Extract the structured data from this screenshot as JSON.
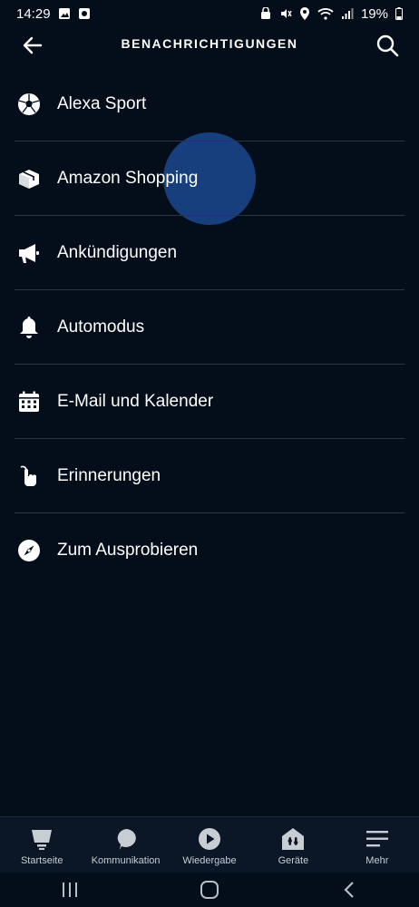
{
  "status_bar": {
    "time": "14:29",
    "battery": "19%"
  },
  "header": {
    "title": "BENACHRICHTIGUNGEN"
  },
  "list": [
    {
      "label": "Alexa Sport",
      "icon": "soccer-ball-icon"
    },
    {
      "label": "Amazon Shopping",
      "icon": "package-icon"
    },
    {
      "label": "Ankündigungen",
      "icon": "megaphone-icon"
    },
    {
      "label": "Automodus",
      "icon": "bell-icon"
    },
    {
      "label": "E-Mail und Kalender",
      "icon": "calendar-icon"
    },
    {
      "label": "Erinnerungen",
      "icon": "tap-hand-icon"
    },
    {
      "label": "Zum Ausprobieren",
      "icon": "compass-icon"
    }
  ],
  "bottom_nav": [
    {
      "label": "Startseite",
      "icon": "home-icon"
    },
    {
      "label": "Kommunikation",
      "icon": "chat-bubble-icon"
    },
    {
      "label": "Wiedergabe",
      "icon": "play-icon"
    },
    {
      "label": "Geräte",
      "icon": "devices-icon"
    },
    {
      "label": "Mehr",
      "icon": "menu-icon"
    }
  ],
  "colors": {
    "background": "#040d1a",
    "ripple": "#1e50a0",
    "divider": "#2a3442"
  }
}
